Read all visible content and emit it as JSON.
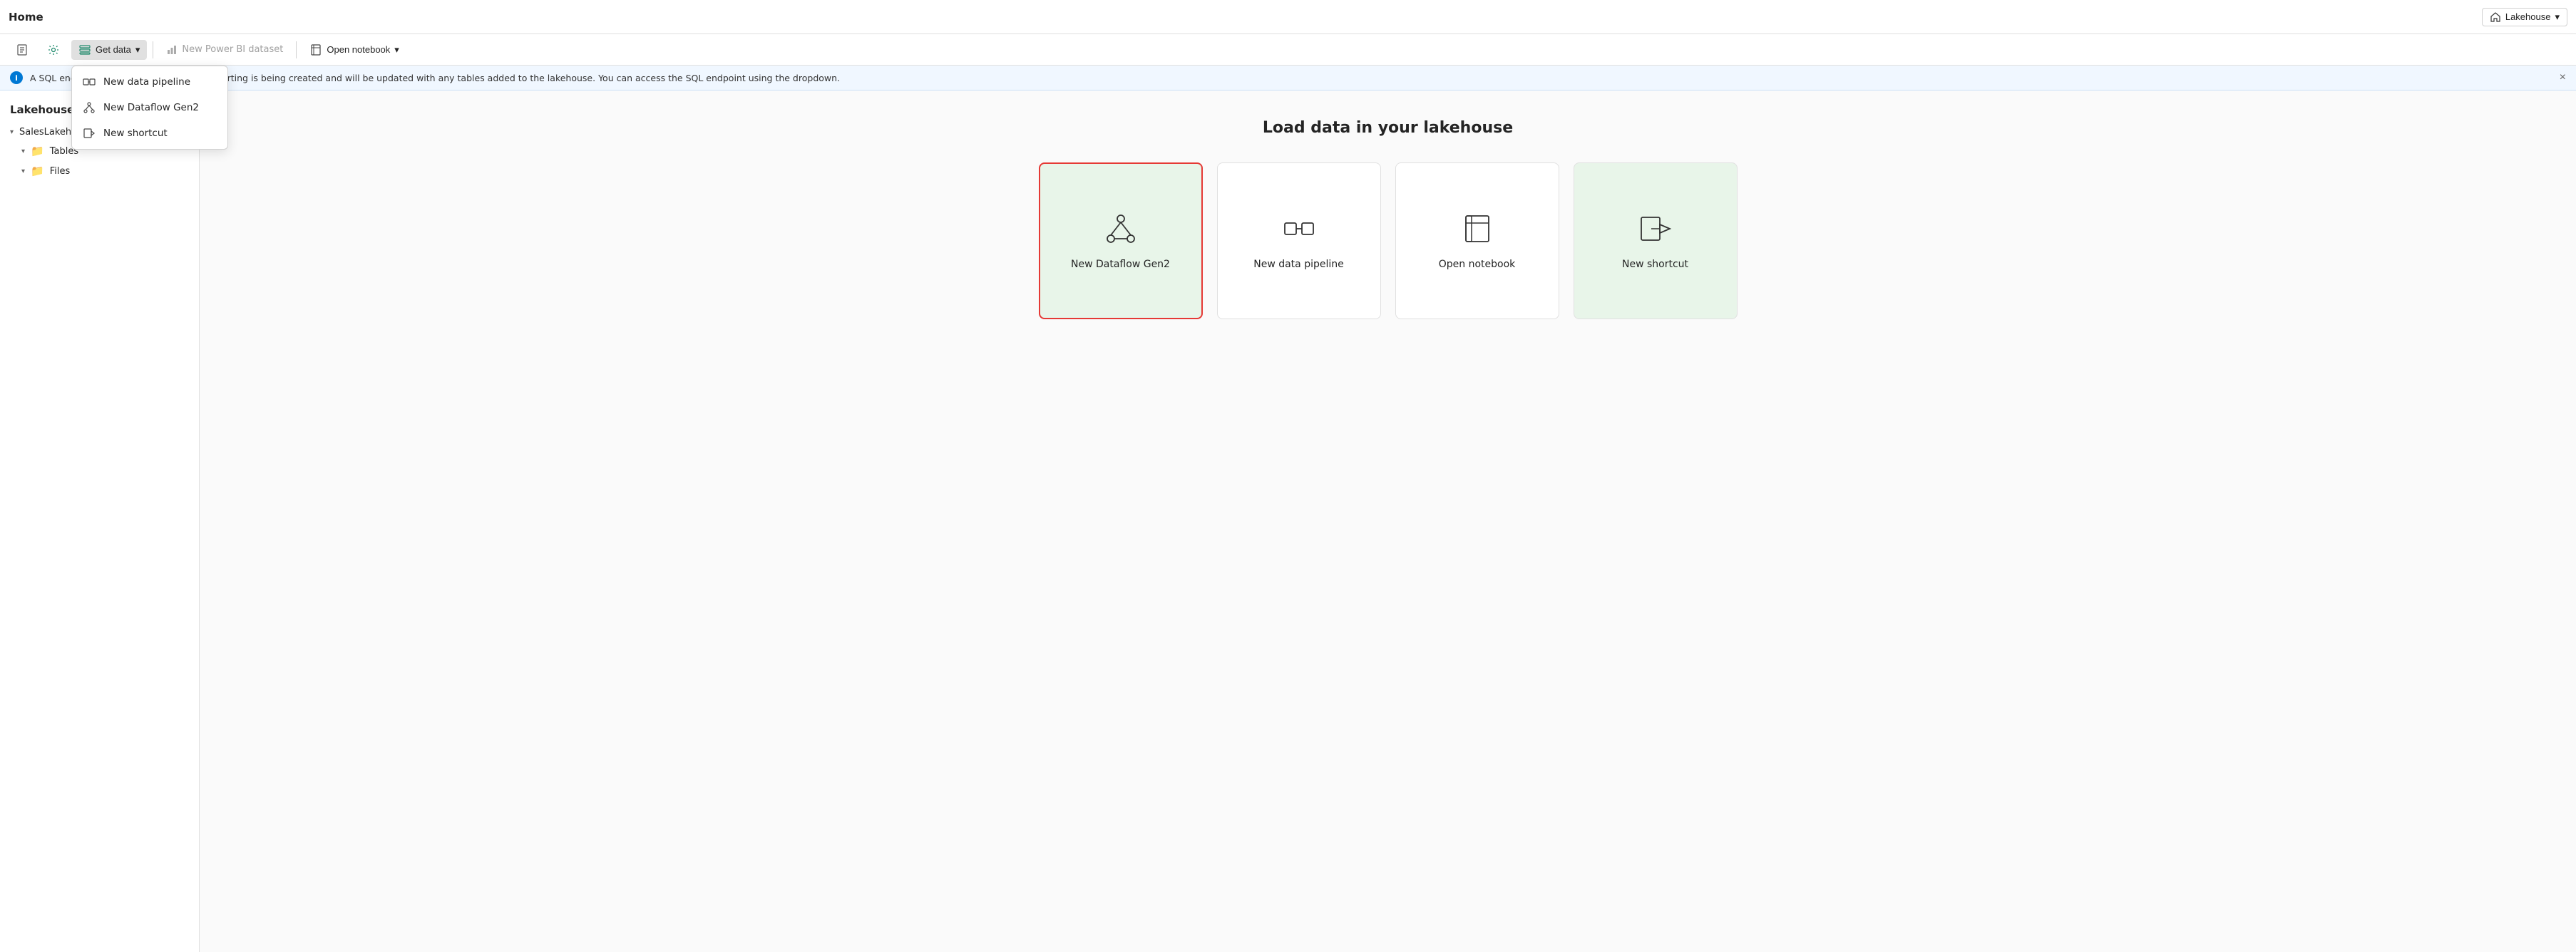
{
  "topbar": {
    "title": "Home",
    "workspace_label": "Lakehouse",
    "workspace_chevron": "▾"
  },
  "toolbar": {
    "doc_icon": "📄",
    "gear_icon": "⚙",
    "get_data_label": "Get data",
    "get_data_chevron": "▾",
    "new_power_bi_label": "New Power BI dataset",
    "open_notebook_label": "Open notebook",
    "open_notebook_chevron": "▾"
  },
  "dropdown": {
    "items": [
      {
        "id": "new-data-pipeline",
        "label": "New data pipeline"
      },
      {
        "id": "new-dataflow-gen2",
        "label": "New Dataflow Gen2"
      },
      {
        "id": "new-shortcut",
        "label": "New shortcut"
      }
    ]
  },
  "banner": {
    "text": "A SQL endpoint and default dataset for reporting is being created and will be updated with any tables added to the lakehouse. You can access the SQL endpoint using the dropdown.",
    "close_label": "×"
  },
  "sidebar": {
    "title": "Lakehouse",
    "lakehouse_name": "SalesLakehouse",
    "tables_label": "Tables",
    "files_label": "Files"
  },
  "main": {
    "section_title": "Load data in your lakehouse",
    "cards": [
      {
        "id": "new-dataflow-gen2",
        "label": "New Dataflow Gen2",
        "highlighted": true,
        "tinted": true
      },
      {
        "id": "new-data-pipeline",
        "label": "New data pipeline",
        "highlighted": false,
        "tinted": false
      },
      {
        "id": "open-notebook",
        "label": "Open notebook",
        "highlighted": false,
        "tinted": false
      },
      {
        "id": "new-shortcut",
        "label": "New shortcut",
        "highlighted": false,
        "tinted": true
      }
    ]
  },
  "colors": {
    "accent": "#0078d4",
    "highlight_border": "#e53935",
    "card_tint": "#e8f5e9"
  }
}
